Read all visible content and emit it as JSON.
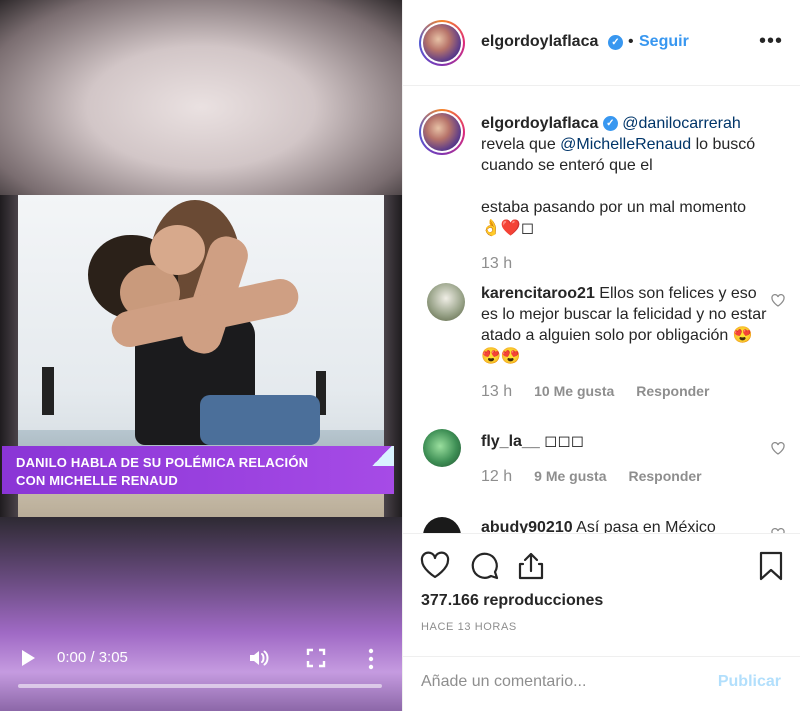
{
  "video": {
    "caption_line1": "Danilo habla de su polémica relación",
    "caption_line2": "con Michelle Renaud",
    "time": "0:00 / 3:05",
    "icons": [
      "play-icon",
      "volume-icon",
      "fullscreen-icon",
      "more-vert-icon"
    ]
  },
  "header": {
    "username": "elgordoylaflaca",
    "dot": "•",
    "follow": "Seguir",
    "options": "•••"
  },
  "post": {
    "username": "elgordoylaflaca",
    "mention1": "@danilocarrerah",
    "text_a": " revela que ",
    "mention2": "@MichelleRenaud",
    "text_b": " lo buscó cuando se enteró que el",
    "text_c": "estaba pasando por un mal momento",
    "emoji": "👌❤️◻",
    "time": "13 h"
  },
  "comments": [
    {
      "username": "karencitaroo21",
      "text": " Ellos son felices y eso es lo mejor buscar la felicidad y no estar atado a alguien solo por obligación 😍😍😍",
      "time": "13 h",
      "likes": "10 Me gusta",
      "reply": "Responder"
    },
    {
      "username": "fly_la__",
      "text": " ◻◻◻",
      "time": "12 h",
      "likes": "9 Me gusta",
      "reply": "Responder"
    },
    {
      "username": "abudy90210",
      "text": " Así pasa en México"
    }
  ],
  "actions": {
    "views": "377.166 reproducciones",
    "ago": "Hace 13 horas",
    "placeholder": "Añade un comentario...",
    "publish": "Publicar"
  },
  "colors": {
    "link": "#3897f0",
    "mention": "#003569",
    "caption_bg": "#9b42e0",
    "muted": "#8e8e8e"
  }
}
